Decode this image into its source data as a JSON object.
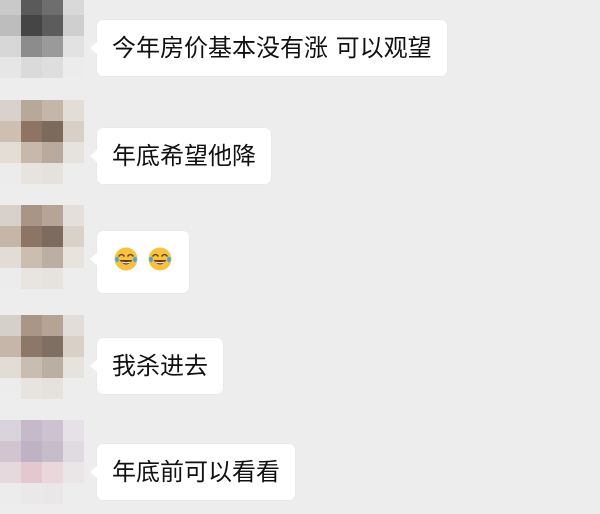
{
  "messages": [
    {
      "type": "text",
      "text": "今年房价基本没有涨 可以观望"
    },
    {
      "type": "text",
      "text": "年底希望他降"
    },
    {
      "type": "emoji",
      "emoji": [
        "face-with-tears-of-joy",
        "face-with-tears-of-joy"
      ]
    },
    {
      "type": "text",
      "text": "我杀进去"
    },
    {
      "type": "text",
      "text": "年底前可以看看"
    }
  ],
  "colors": {
    "background": "#ededed",
    "bubble": "#ffffff",
    "text": "#111111",
    "emoji_face": "#f7c23e",
    "emoji_tear": "#3ea7f0"
  }
}
